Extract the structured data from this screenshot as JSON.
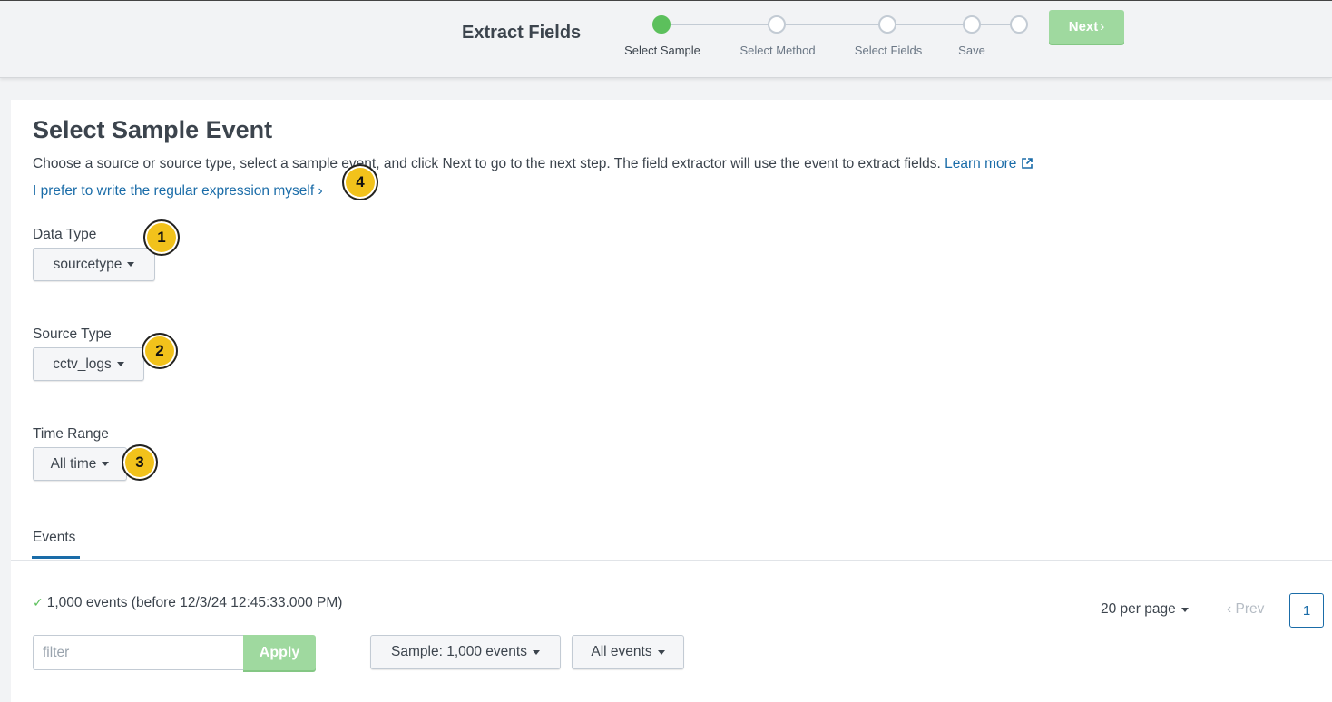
{
  "header": {
    "title": "Extract Fields",
    "next_label": "Next",
    "steps": [
      {
        "label": "Select Sample",
        "active": true
      },
      {
        "label": "Select Method",
        "active": false
      },
      {
        "label": "Select Fields",
        "active": false
      },
      {
        "label": "Save",
        "active": false
      }
    ]
  },
  "main": {
    "heading": "Select Sample Event",
    "description": "Choose a source or source type, select a sample event, and click Next to go to the next step. The field extractor will use the event to extract fields.",
    "learn_more": "Learn more",
    "regex_link": "I prefer to write the regular expression myself",
    "data_type": {
      "label": "Data Type",
      "value": "sourcetype"
    },
    "source_type": {
      "label": "Source Type",
      "value": "cctv_logs"
    },
    "time_range": {
      "label": "Time Range",
      "value": "All time"
    }
  },
  "events": {
    "tab_label": "Events",
    "status": "1,000 events (before 12/3/24 12:45:33.000 PM)",
    "per_page": "20 per page",
    "prev_label": "Prev",
    "current_page": "1",
    "filter_placeholder": "filter",
    "apply_label": "Apply",
    "sample_label": "Sample: 1,000 events",
    "all_events_label": "All events"
  },
  "badges": [
    "1",
    "2",
    "3",
    "4"
  ],
  "colors": {
    "accent_green": "#5cc05c",
    "disabled_green": "#9fd99f",
    "link_blue": "#1a6ca8",
    "badge_yellow": "#f2c21b"
  }
}
